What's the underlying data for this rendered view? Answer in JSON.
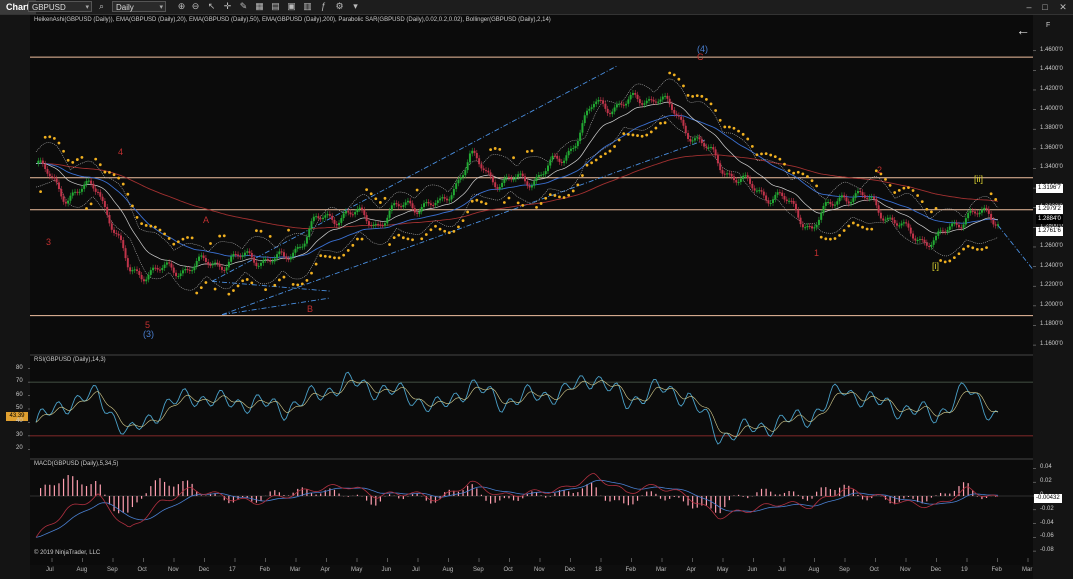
{
  "toolbar": {
    "chart_tab": "Chart",
    "instrument": "GBPUSD",
    "period": "Daily",
    "icons": [
      "search-icon",
      "zoom-in-icon",
      "zoom-out-icon",
      "pointer-icon",
      "crosshair-icon",
      "draw-icon",
      "grid-icon",
      "properties-icon",
      "data-box-icon",
      "template-icon",
      "indicators-icon",
      "strategies-icon",
      "drawing-tools-icon"
    ]
  },
  "price_panel": {
    "indicator_title": "HeikenAshi(GBPUSD (Daily)), EMA(GBPUSD (Daily),20), EMA(GBPUSD (Daily),50), EMA(GBPUSD (Daily),200), Parabolic SAR(GBPUSD (Daily),0.02,0.2,0.02), Bollinger(GBPUSD (Daily),2,14)",
    "y_ticks": [
      "1.4600'0",
      "1.4400'0",
      "1.4200'0",
      "1.4000'0",
      "1.3800'0",
      "1.3600'0",
      "1.3400'0",
      "1.3200'0",
      "1.3000'0",
      "1.2800'0",
      "1.2600'0",
      "1.2400'0",
      "1.2200'0",
      "1.2000'0",
      "1.1800'0",
      "1.1600'0"
    ],
    "price_tags": [
      {
        "label": "1.3196'7",
        "bg": "#ffffff",
        "fg": "#000000"
      },
      {
        "label": "1.2979'2",
        "bg": "#ffffff",
        "fg": "#000000"
      },
      {
        "label": "1.2884'0",
        "bg": "#000000",
        "fg": "#ffffff"
      },
      {
        "label": "1.2761'6",
        "bg": "#ffffff",
        "fg": "#000000"
      }
    ],
    "wave_labels": [
      {
        "text": "3",
        "color": "#c03030"
      },
      {
        "text": "4",
        "color": "#c03030"
      },
      {
        "text": "5",
        "color": "#c03030"
      },
      {
        "text": "(3)",
        "color": "#4a7fd0"
      },
      {
        "text": "A",
        "color": "#c03030"
      },
      {
        "text": "B",
        "color": "#c03030"
      },
      {
        "text": "(4)",
        "color": "#4a7fd0"
      },
      {
        "text": "C",
        "color": "#c03030"
      },
      {
        "text": "1",
        "color": "#c03030"
      },
      {
        "text": "2",
        "color": "#c03030"
      },
      {
        "text": "[i]",
        "color": "#d8d030"
      },
      {
        "text": "[ii]",
        "color": "#d8d030"
      }
    ],
    "back_button": "←",
    "f_button": "F"
  },
  "rsi_panel": {
    "title": "RSI(GBPUSD (Daily),14,3)",
    "y_ticks": [
      "80",
      "70",
      "60",
      "50",
      "40",
      "30",
      "20"
    ],
    "current_value": "43.39"
  },
  "macd_panel": {
    "title": "MACD(GBPUSD (Daily),5,34,5)",
    "y_ticks": [
      "0.04",
      "0.02",
      "0",
      "-0.02",
      "-0.04",
      "-0.06",
      "-0.08"
    ],
    "current_value": "-0.00432"
  },
  "copyright": "© 2019 NinjaTrader, LLC",
  "x_axis": [
    "Jul",
    "Aug",
    "Sep",
    "Oct",
    "Nov",
    "Dec",
    "17",
    "Feb",
    "Mar",
    "Apr",
    "May",
    "Jun",
    "Jul",
    "Aug",
    "Sep",
    "Oct",
    "Nov",
    "Dec",
    "18",
    "Feb",
    "Mar",
    "Apr",
    "May",
    "Jun",
    "Jul",
    "Aug",
    "Sep",
    "Oct",
    "Nov",
    "Dec",
    "19",
    "Feb",
    "Mar"
  ],
  "chart_data": [
    {
      "type": "line",
      "title": "HeikenAshi(GBPUSD (Daily)), EMA(GBPUSD (Daily),20), EMA(GBPUSD (Daily),50), EMA(GBPUSD (Daily),200), Parabolic SAR(GBPUSD (Daily),0.02,0.2,0.02), Bollinger(GBPUSD (Daily),2,14)",
      "x": [
        "Jul",
        "Aug",
        "Sep",
        "Oct",
        "Nov",
        "Dec",
        "17",
        "Feb",
        "Mar",
        "Apr",
        "May",
        "Jun",
        "Jul",
        "Aug",
        "Sep",
        "Oct",
        "Nov",
        "Dec",
        "18",
        "Feb",
        "Mar",
        "Apr",
        "May",
        "Jun",
        "Jul",
        "Aug",
        "Sep",
        "Oct",
        "Nov",
        "Dec",
        "19",
        "Feb"
      ],
      "series": [
        {
          "name": "GBPUSD",
          "values": [
            1.345,
            1.312,
            1.322,
            1.235,
            1.235,
            1.24,
            1.245,
            1.25,
            1.245,
            1.285,
            1.295,
            1.285,
            1.305,
            1.3,
            1.35,
            1.325,
            1.33,
            1.35,
            1.405,
            1.405,
            1.415,
            1.38,
            1.345,
            1.32,
            1.31,
            1.28,
            1.315,
            1.305,
            1.275,
            1.265,
            1.295,
            1.288
          ]
        }
      ],
      "horizontal_levels": [
        1.4535,
        1.3305,
        1.2979,
        1.19
      ],
      "ylim": [
        1.155,
        1.475
      ]
    },
    {
      "type": "line",
      "title": "RSI(GBPUSD (Daily),14,3)",
      "x": [
        "Jul",
        "Aug",
        "Sep",
        "Oct",
        "Nov",
        "Dec",
        "17",
        "Feb",
        "Mar",
        "Apr",
        "May",
        "Jun",
        "Jul",
        "Aug",
        "Sep",
        "Oct",
        "Nov",
        "Dec",
        "18",
        "Feb",
        "Mar",
        "Apr",
        "May",
        "Jun",
        "Jul",
        "Aug",
        "Sep",
        "Oct",
        "Nov",
        "Dec",
        "19",
        "Feb"
      ],
      "series": [
        {
          "name": "RSI",
          "values": [
            40,
            55,
            60,
            30,
            50,
            60,
            55,
            55,
            50,
            60,
            70,
            65,
            60,
            50,
            68,
            55,
            60,
            62,
            75,
            55,
            65,
            60,
            30,
            35,
            40,
            45,
            65,
            55,
            50,
            45,
            65,
            43.39
          ]
        }
      ],
      "levels": [
        70,
        30
      ],
      "ylim": [
        15,
        85
      ]
    },
    {
      "type": "line",
      "title": "MACD(GBPUSD (Daily),5,34,5)",
      "x": [
        "Jul",
        "Aug",
        "Sep",
        "Oct",
        "Nov",
        "Dec",
        "17",
        "Feb",
        "Mar",
        "Apr",
        "May",
        "Jun",
        "Jul",
        "Aug",
        "Sep",
        "Oct",
        "Nov",
        "Dec",
        "18",
        "Feb",
        "Mar",
        "Apr",
        "May",
        "Jun",
        "Jul",
        "Aug",
        "Sep",
        "Oct",
        "Nov",
        "Dec",
        "19",
        "Feb"
      ],
      "series": [
        {
          "name": "MACD",
          "values": [
            -0.06,
            -0.02,
            0.0,
            -0.05,
            -0.01,
            0.01,
            0.0,
            -0.01,
            0.0,
            0.01,
            0.015,
            0.0,
            0.005,
            -0.005,
            0.02,
            0.0,
            0.005,
            0.01,
            0.03,
            0.005,
            0.015,
            0.0,
            -0.03,
            -0.02,
            -0.01,
            -0.015,
            0.01,
            0.0,
            -0.01,
            -0.015,
            0.01,
            -0.00432
          ]
        }
      ],
      "ylim": [
        -0.09,
        0.045
      ]
    }
  ],
  "colors": {
    "background": "#0b0b0b",
    "bull": "#22aa33",
    "bear": "#c0344a",
    "sar": "#f0b020",
    "ema_fast": "#d0d0d0",
    "ema_mid": "#3a6fd0",
    "ema_slow": "#a03030",
    "channel": "#4a8fe0",
    "level": "#f0c0a0",
    "rsi_line": "#4aa0c8",
    "macd_hist": "#ff9fb0"
  }
}
